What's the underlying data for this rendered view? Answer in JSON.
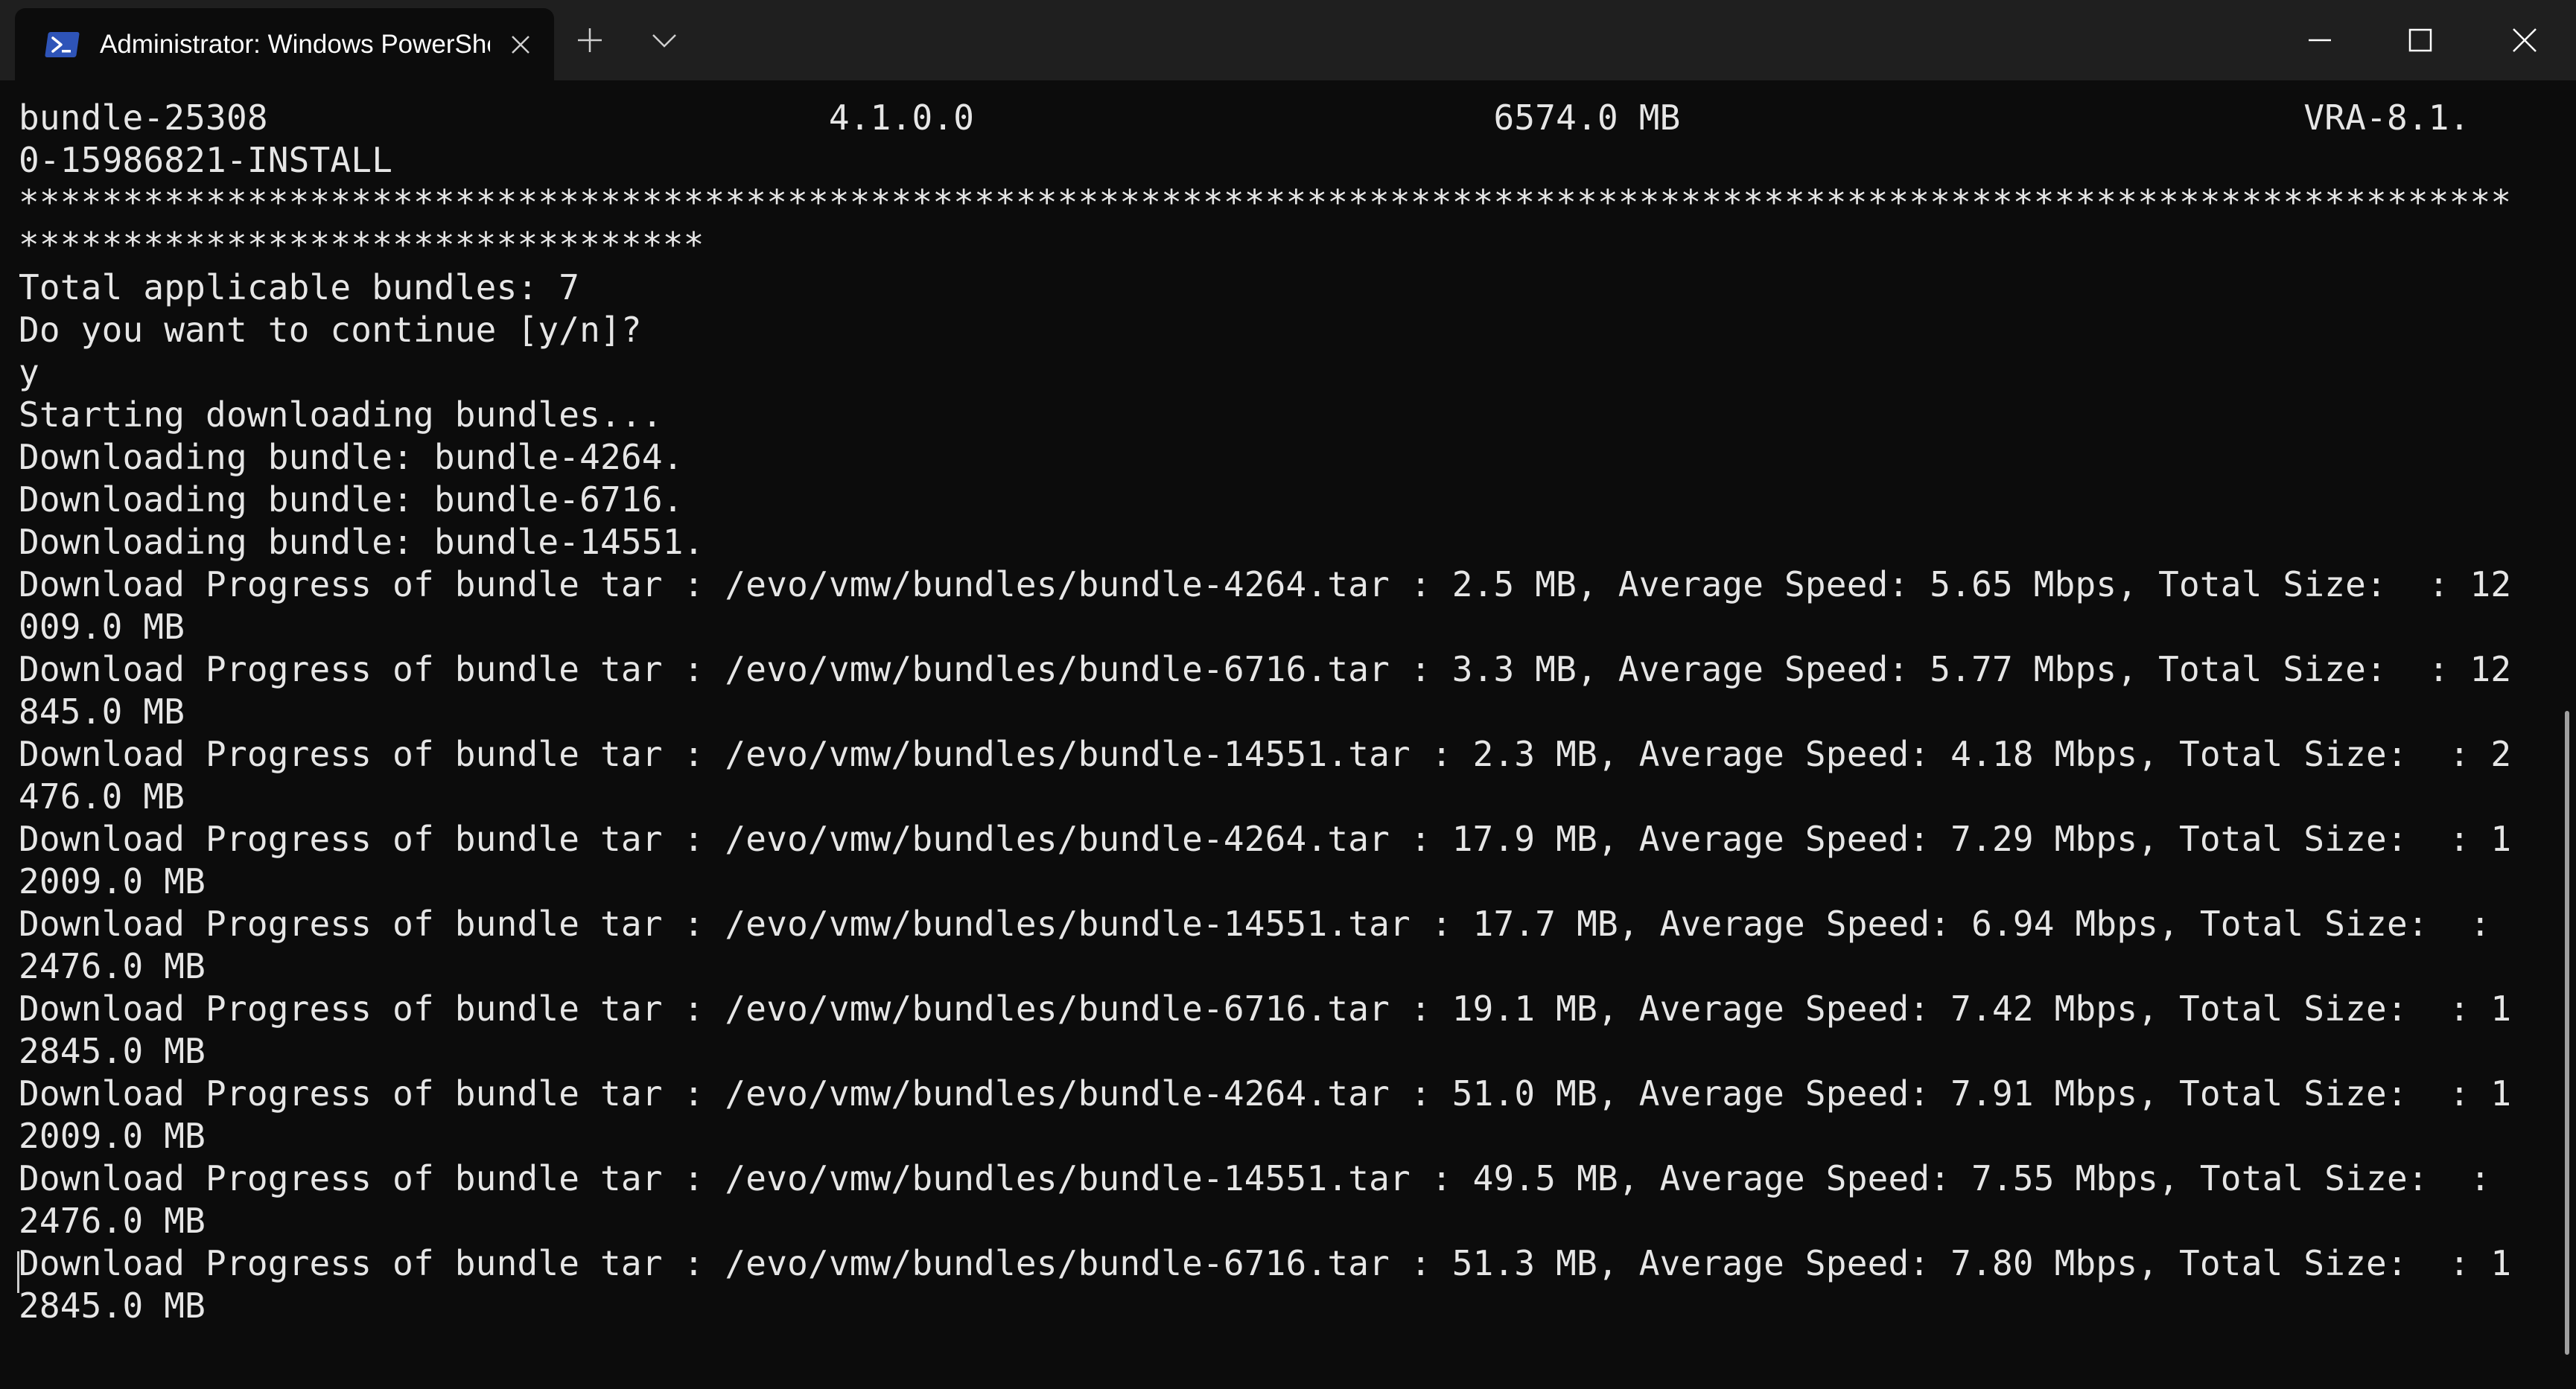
{
  "tab": {
    "title": "Administrator: Windows PowerShell",
    "icon": "powershell-icon"
  },
  "titlebar": {
    "new_tab_icon": "plus-icon",
    "dropdown_icon": "chevron-down-icon",
    "minimize_icon": "minimize-icon",
    "maximize_icon": "maximize-icon",
    "close_icon": "close-icon"
  },
  "colors": {
    "terminal_background": "#0c0c0c",
    "terminal_text": "#e6e6e6",
    "tabbar_background": "#1f1f1f",
    "powershell_icon": "#2e54b8"
  },
  "terminal": {
    "lines": [
      "bundle-25308                           4.1.0.0                         6574.0 MB                              VRA-8.1.",
      "0-15986821-INSTALL",
      "************************************************************************************************************************",
      "*********************************",
      "Total applicable bundles: 7",
      "Do you want to continue [y/n]?",
      "y",
      "Starting downloading bundles...",
      "Downloading bundle: bundle-4264.",
      "Downloading bundle: bundle-6716.",
      "Downloading bundle: bundle-14551.",
      "Download Progress of bundle tar : /evo/vmw/bundles/bundle-4264.tar : 2.5 MB, Average Speed: 5.65 Mbps, Total Size:  : 12",
      "009.0 MB",
      "Download Progress of bundle tar : /evo/vmw/bundles/bundle-6716.tar : 3.3 MB, Average Speed: 5.77 Mbps, Total Size:  : 12",
      "845.0 MB",
      "Download Progress of bundle tar : /evo/vmw/bundles/bundle-14551.tar : 2.3 MB, Average Speed: 4.18 Mbps, Total Size:  : 2",
      "476.0 MB",
      "Download Progress of bundle tar : /evo/vmw/bundles/bundle-4264.tar : 17.9 MB, Average Speed: 7.29 Mbps, Total Size:  : 1",
      "2009.0 MB",
      "Download Progress of bundle tar : /evo/vmw/bundles/bundle-14551.tar : 17.7 MB, Average Speed: 6.94 Mbps, Total Size:  :",
      "2476.0 MB",
      "Download Progress of bundle tar : /evo/vmw/bundles/bundle-6716.tar : 19.1 MB, Average Speed: 7.42 Mbps, Total Size:  : 1",
      "2845.0 MB",
      "Download Progress of bundle tar : /evo/vmw/bundles/bundle-4264.tar : 51.0 MB, Average Speed: 7.91 Mbps, Total Size:  : 1",
      "2009.0 MB",
      "Download Progress of bundle tar : /evo/vmw/bundles/bundle-14551.tar : 49.5 MB, Average Speed: 7.55 Mbps, Total Size:  :",
      "2476.0 MB",
      "Download Progress of bundle tar : /evo/vmw/bundles/bundle-6716.tar : 51.3 MB, Average Speed: 7.80 Mbps, Total Size:  : 1",
      "2845.0 MB"
    ]
  }
}
